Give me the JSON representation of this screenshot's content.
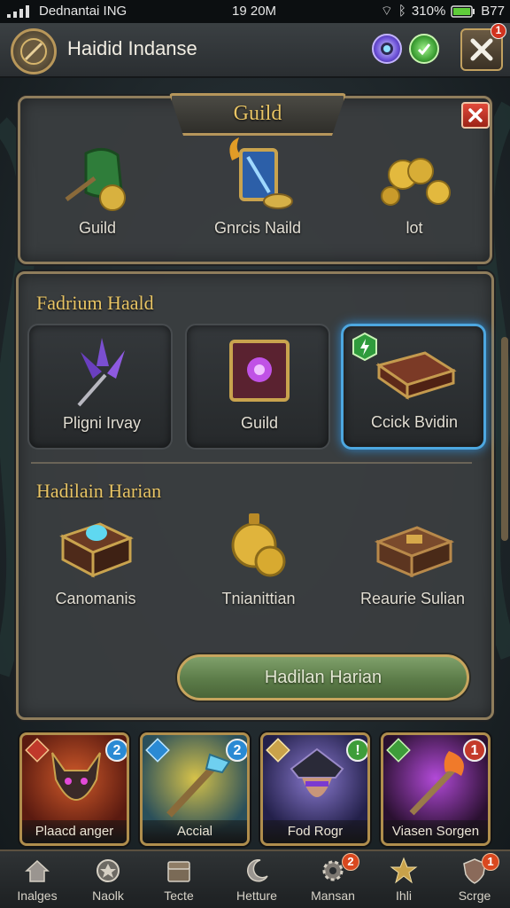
{
  "status_bar": {
    "carrier": "Dednantai ING",
    "clock": "19 20M",
    "battery": "310%",
    "network": "B77"
  },
  "header": {
    "title": "Haidid Indanse"
  },
  "guild_panel": {
    "title": "Guild",
    "items": [
      {
        "label": "Guild",
        "icon": "guild-bag-icon"
      },
      {
        "label": "Gnrcis Naild",
        "icon": "crystal-chest-icon"
      },
      {
        "label": "lot",
        "icon": "gold-coins-icon"
      }
    ]
  },
  "main_panel": {
    "section1": {
      "title": "Fadrium Haald",
      "slots": [
        {
          "label": "Pligni Irvay",
          "icon": "crystal-weapon-icon"
        },
        {
          "label": "Guild",
          "icon": "guild-tome-icon"
        },
        {
          "label": "Ccick Bvidin",
          "icon": "leather-case-icon",
          "selected": true
        }
      ]
    },
    "section2": {
      "title": "Hadilain Harian",
      "items": [
        {
          "label": "Canomanis",
          "icon": "gem-chest-icon"
        },
        {
          "label": "Tnianittian",
          "icon": "gold-medal-icon"
        },
        {
          "label": "Reaurie Sulian",
          "icon": "wooden-box-icon"
        }
      ]
    },
    "action_button": "Hadilan Harian"
  },
  "cards": [
    {
      "name": "Plaacd anger",
      "badge": "2",
      "badge_color": "#2a8ad4",
      "art": "demon-warrior-icon"
    },
    {
      "name": "Accial",
      "badge": "2",
      "badge_color": "#2a8ad4",
      "art": "lightning-staff-icon"
    },
    {
      "name": "Fod Rogr",
      "badge": "!",
      "badge_color": "#3e9d3a",
      "art": "dark-rogue-icon"
    },
    {
      "name": "Viasen Sorgen",
      "badge": "1",
      "badge_color": "#c43a2a",
      "art": "fire-staff-icon"
    }
  ],
  "nav": [
    {
      "label": "Inalges",
      "icon": "home-icon"
    },
    {
      "label": "Naolk",
      "icon": "emblem-icon"
    },
    {
      "label": "Tecte",
      "icon": "chest-icon"
    },
    {
      "label": "Hetture",
      "icon": "moon-icon"
    },
    {
      "label": "Mansan",
      "icon": "gear-icon",
      "badge": "2"
    },
    {
      "label": "Ihli",
      "icon": "star-icon"
    },
    {
      "label": "Scrge",
      "icon": "shield-icon",
      "badge": "1"
    }
  ],
  "colors": {
    "gold": "#e9c565",
    "frame": "#8f7d5c",
    "selected": "#4da7e0",
    "button_green": "#5c7c49",
    "close_red": "#c0392b"
  }
}
